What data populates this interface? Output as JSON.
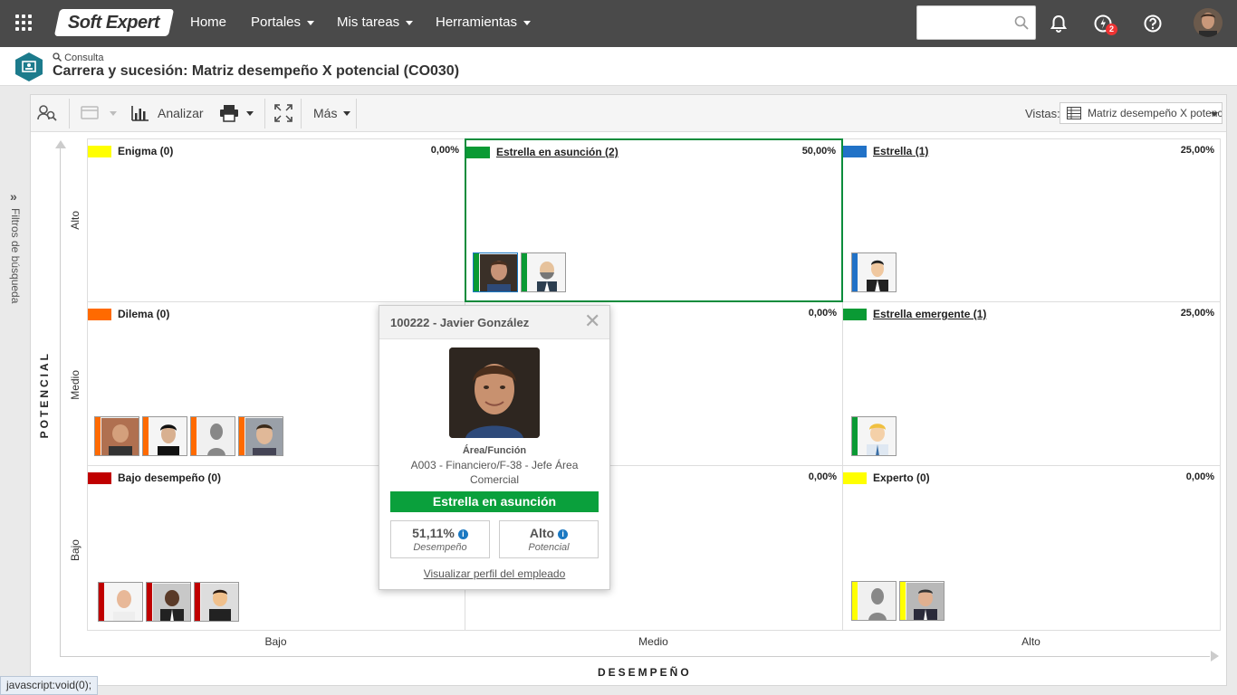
{
  "topbar": {
    "logo": "Soft Expert",
    "nav": [
      "Home",
      "Portales",
      "Mis tareas",
      "Herramientas"
    ],
    "search_placeholder": "",
    "notification_badge": "2"
  },
  "header": {
    "consulta_label": "Consulta",
    "title": "Carrera y sucesión: Matriz desempeño X potencial (CO030)"
  },
  "sidebar": {
    "filtros_label": "Filtros de búsqueda"
  },
  "toolbar": {
    "analizar": "Analizar",
    "mas": "Más",
    "vistas_label": "Vistas:",
    "vistas_value": "Matriz desempeño X potencial"
  },
  "axes": {
    "y_title": "POTENCIAL",
    "x_title": "DESEMPEÑO",
    "y_levels": [
      "Alto",
      "Medio",
      "Bajo"
    ],
    "x_levels": [
      "Bajo",
      "Medio",
      "Alto"
    ]
  },
  "colors": {
    "yellow": "#ffff00",
    "green": "#0a9a34",
    "blue": "#2172c7",
    "orange": "#ff6a00",
    "red": "#c00000",
    "status_green": "#0aa03c"
  },
  "matrix": {
    "cells": [
      {
        "title": "Enigma (0)",
        "pct": "0,00%"
      },
      {
        "title": "Estrella en asunción (2)",
        "pct": "50,00%"
      },
      {
        "title": "Estrella (1)",
        "pct": "25,00%"
      },
      {
        "title": "Dilema (0)",
        "pct": ""
      },
      {
        "title": "",
        "pct": "0,00%"
      },
      {
        "title": "Estrella emergente (1)",
        "pct": "25,00%"
      },
      {
        "title": "Bajo desempeño (0)",
        "pct": ""
      },
      {
        "title": "",
        "pct": "0,00%"
      },
      {
        "title": "Experto (0)",
        "pct": "0,00%"
      }
    ]
  },
  "popup": {
    "title": "100222 - Javier González",
    "area_label": "Área/Función",
    "area_value": "A003 - Financiero/F-38 - Jefe Área Comercial",
    "status": "Estrella en asunción",
    "desempeno_value": "51,11%",
    "desempeno_label": "Desempeño",
    "potencial_value": "Alto",
    "potencial_label": "Potencial",
    "link": "Visualizar perfil del empleado"
  },
  "statusbar": "javascript:void(0);"
}
